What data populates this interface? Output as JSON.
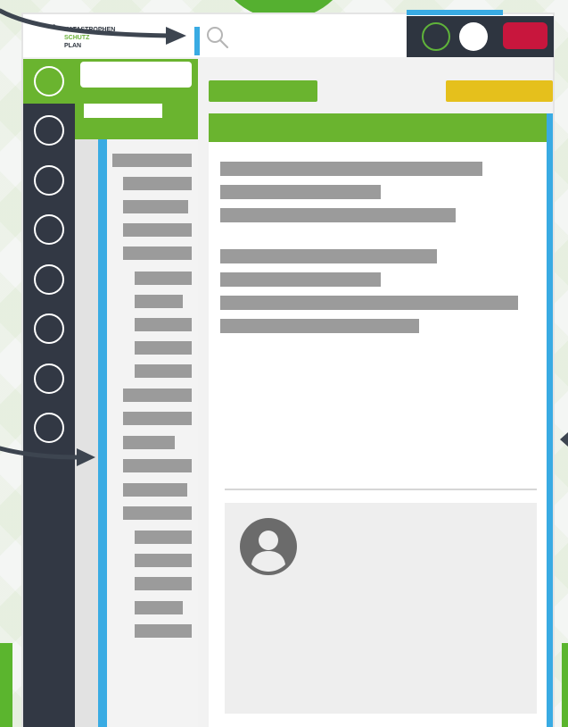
{
  "logo": {
    "dots": "•·•",
    "line1": "KATASTROPHEN",
    "line2": "SCHUTZ",
    "line3": "PLAN"
  },
  "header": {
    "search_icon": "search-icon",
    "toolbar_icons": [
      "status-circle-outline",
      "status-circle-filled",
      "alert-badge"
    ]
  },
  "colors": {
    "brand_green": "#6ab42f",
    "accent_blue": "#39abe3",
    "rail_dark": "#323844",
    "alert_red": "#c8163d",
    "highlight_yellow": "#e5c01c"
  },
  "main": {
    "comment": {
      "avatar_icon": "user-avatar-icon"
    }
  }
}
